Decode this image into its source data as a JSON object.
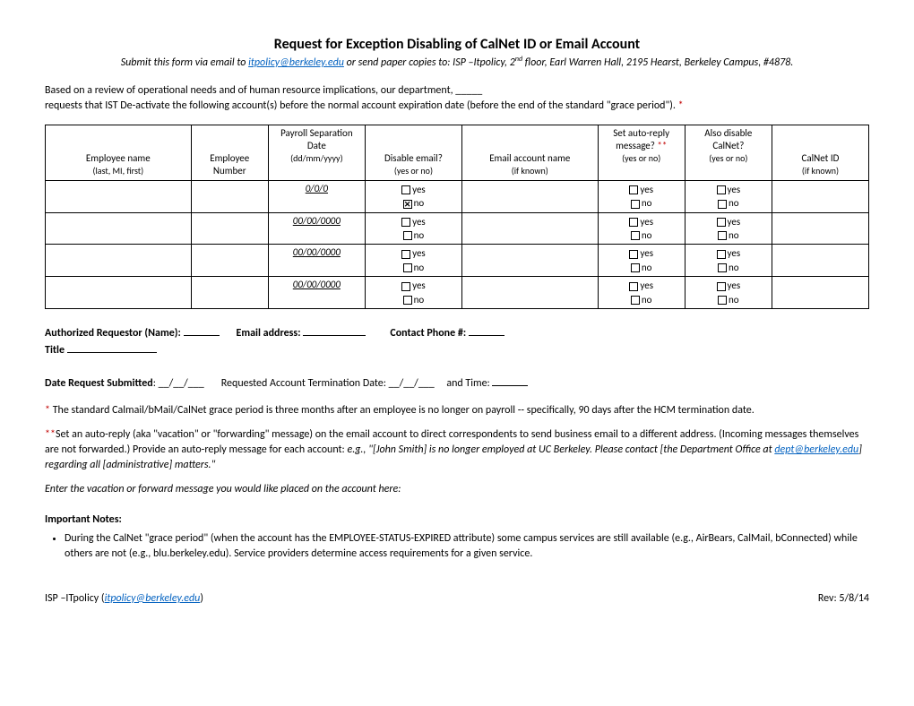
{
  "header": {
    "title": "Request for Exception Disabling of CalNet ID or Email Account",
    "submit_prefix": "Submit this form via email to ",
    "submit_email": "itpolicy@berkeley.edu",
    "submit_mid": " or send paper copies to: ",
    "submit_suffix_plain": "ISP –Itpolicy, 2",
    "submit_suffix_sup": "nd",
    "submit_suffix_tail": " floor, Earl Warren Hall, 2195 Hearst, Berkeley Campus, #4878."
  },
  "intro": {
    "line1": "Based on a review of operational needs and of human resource implications, our department, _____",
    "line2": "requests that IST De-activate the following account(s) before the normal account expiration date (before the end of the standard \"grace period\").  ",
    "asterisk": "*"
  },
  "table": {
    "headers": {
      "employee_name": "Employee name",
      "employee_name_sub": "(last, MI, first)",
      "employee_number": "Employee Number",
      "payroll_sep": "Payroll Separation Date",
      "payroll_sep_sub": "(dd/mm/yyyy)",
      "disable_email": "Disable email?",
      "disable_email_sub": "(yes or no)",
      "email_account": "Email account name",
      "email_account_sub": "(if known)",
      "set_autoreply": "Set auto-reply message? ",
      "set_autoreply_mark": "**",
      "set_autoreply_sub": "(yes or no)",
      "also_disable": "Also disable CalNet?",
      "also_disable_sub": "(yes or no)",
      "calnet_id": "CalNet ID",
      "calnet_id_sub": "(if known)"
    },
    "rows": [
      {
        "date": "0/0/0",
        "disable_email_yes": false,
        "disable_email_no": true,
        "autoreply_yes": false,
        "autoreply_no": false,
        "also_yes": false,
        "also_no": false
      },
      {
        "date": "00/00/0000",
        "disable_email_yes": false,
        "disable_email_no": false,
        "autoreply_yes": false,
        "autoreply_no": false,
        "also_yes": false,
        "also_no": false
      },
      {
        "date": "00/00/0000",
        "disable_email_yes": false,
        "disable_email_no": false,
        "autoreply_yes": false,
        "autoreply_no": false,
        "also_yes": false,
        "also_no": false
      },
      {
        "date": "00/00/0000",
        "disable_email_yes": false,
        "disable_email_no": false,
        "autoreply_yes": false,
        "autoreply_no": false,
        "also_yes": false,
        "also_no": false
      }
    ],
    "yes_label": "yes",
    "no_label": "no"
  },
  "requestor": {
    "name_label": "Authorized Requestor (Name): ",
    "email_label": "Email address: ",
    "phone_label": "Contact Phone #: ",
    "title_label": "Title "
  },
  "dates": {
    "submitted_label": "Date Request Submitted",
    "termination_label": "Requested Account Termination Date: ",
    "time_label": "and Time: "
  },
  "footnotes": {
    "star1": "*",
    "star1_text": " The standard Calmail/bMail/CalNet grace period is three months after an employee is no longer on payroll -- specifically, 90 days after the HCM termination date.",
    "star2": "**",
    "star2_text": "Set an auto-reply (aka \"vacation\" or \"forwarding\" message) on the email account to direct correspondents to send business email to a different address. (Incoming messages themselves are not forwarded.) Provide an auto-reply message for each account: ",
    "star2_example_prefix": "e.g., \"[John Smith] is no longer employed at UC Berkeley. Please contact [the Department Office at ",
    "star2_example_link": "dept@berkeley.edu",
    "star2_example_suffix": "] regarding all [administrative] matters.\"",
    "enter_vacation": "Enter the vacation or forward message you would like placed on the account here:"
  },
  "important": {
    "heading": "Important Notes:",
    "bullet1": "During the CalNet \"grace period\" (when the account has the EMPLOYEE-STATUS-EXPIRED attribute) some campus services are still available (e.g., AirBears, CalMail, bConnected) while others are not (e.g., blu.berkeley.edu). Service providers determine access requirements for a given service."
  },
  "footer": {
    "left_prefix": "ISP –ITpolicy (",
    "left_link": "itpolicy@berkeley.edu",
    "left_suffix": ")",
    "right": "Rev: 5/8/14"
  }
}
